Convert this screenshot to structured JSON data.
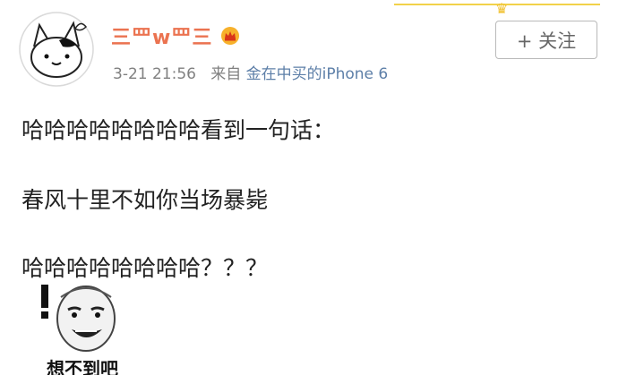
{
  "post": {
    "nickname": "三罒w罒三",
    "time": "3-21 21:56",
    "from_label": "来自",
    "source": "金在中买的iPhone 6",
    "follow_label": "+ 关注",
    "lines": [
      "哈哈哈哈哈哈哈哈看到一句话：",
      "春风十里不如你当场暴毙",
      "哈哈哈哈哈哈哈哈？？？"
    ],
    "meme_caption": "想不到吧"
  },
  "colors": {
    "nickname": "#eb7350",
    "source_link": "#5d7fa8",
    "meta": "#808080",
    "accent_gold": "#f1c232"
  },
  "icons": {
    "avatar": "cat-avatar-icon",
    "vip": "crown-badge-icon",
    "meme": "meme-face-icon"
  }
}
